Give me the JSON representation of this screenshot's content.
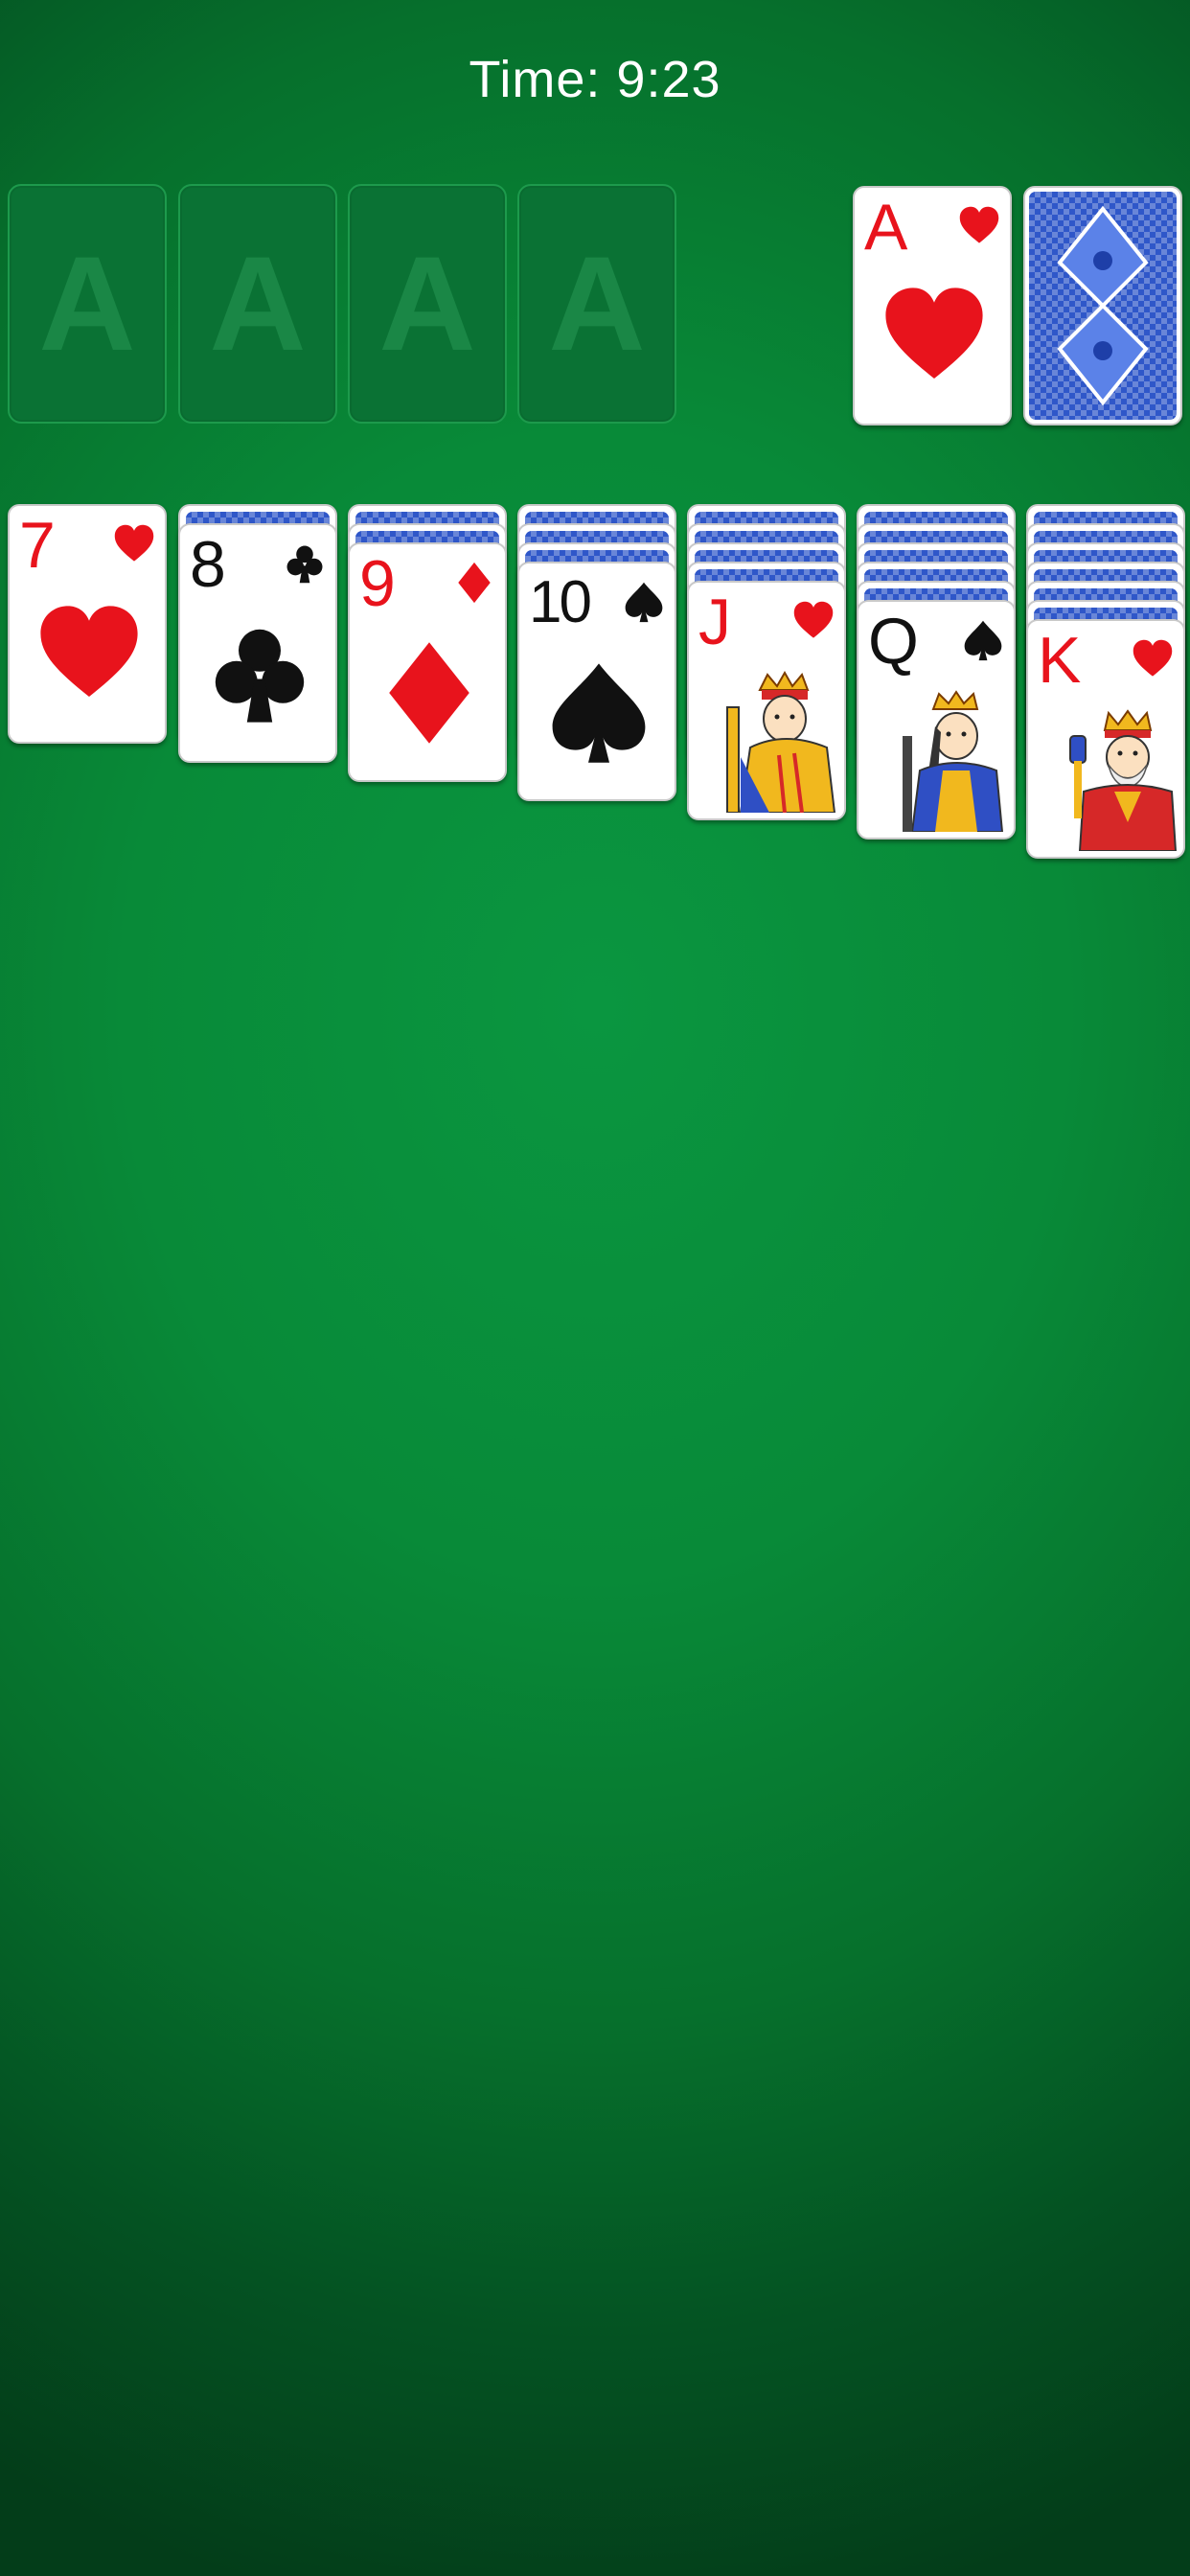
{
  "timer": {
    "label": "Time: 9:23"
  },
  "foundations": [
    {
      "placeholder": "A"
    },
    {
      "placeholder": "A"
    },
    {
      "placeholder": "A"
    },
    {
      "placeholder": "A"
    }
  ],
  "waste": {
    "rank": "A",
    "suit": "hearts",
    "color": "#e8131c"
  },
  "stock": {
    "back_color": "#2f57c9"
  },
  "tableau": [
    {
      "hidden": 0,
      "rank": "7",
      "suit": "hearts",
      "color": "#e8131c"
    },
    {
      "hidden": 1,
      "rank": "8",
      "suit": "clubs",
      "color": "#111111"
    },
    {
      "hidden": 2,
      "rank": "9",
      "suit": "diamonds",
      "color": "#e8131c"
    },
    {
      "hidden": 3,
      "rank": "10",
      "suit": "spades",
      "color": "#111111"
    },
    {
      "hidden": 4,
      "rank": "J",
      "suit": "hearts",
      "color": "#e8131c"
    },
    {
      "hidden": 5,
      "rank": "Q",
      "suit": "spades",
      "color": "#111111"
    },
    {
      "hidden": 6,
      "rank": "K",
      "suit": "hearts",
      "color": "#e8131c"
    }
  ]
}
